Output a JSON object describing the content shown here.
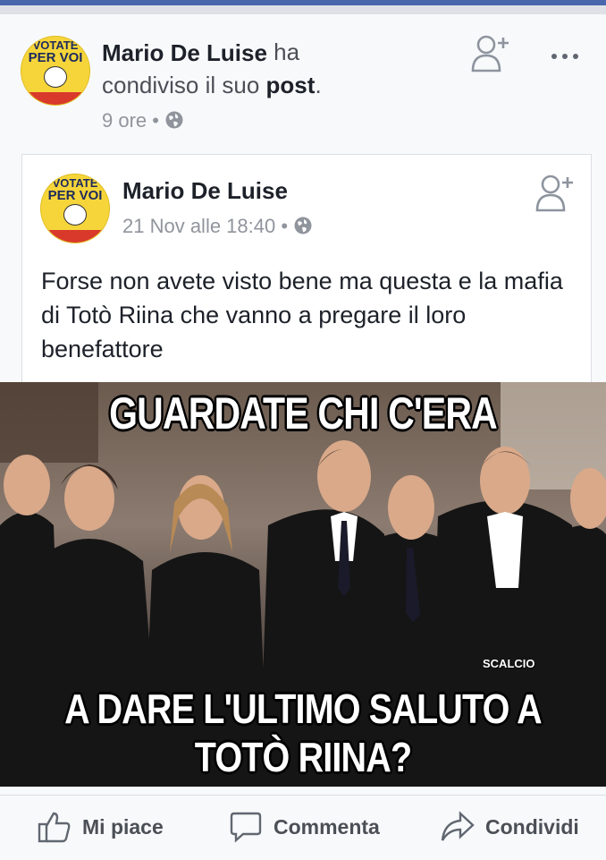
{
  "shared_post": {
    "author": "Mario De Luise",
    "action_prefix": "ha",
    "action_line2": "condiviso il suo",
    "action_bold": "post",
    "action_end": ".",
    "time": "9 ore",
    "separator": "•",
    "avatar_text": "VOTATE PER VOI",
    "avatar_icon": "movimento-logo"
  },
  "original_post": {
    "author": "Mario De Luise",
    "time": "21 Nov alle 18:40",
    "separator": "•",
    "text": "Forse non avete visto bene ma questa e la mafia di Totò Riina che vanno a pregare il loro benefattore",
    "avatar_text": "VOTATE PER VOI"
  },
  "image": {
    "top_caption": "GUARDATE CHI C'ERA",
    "bottom_caption_line1": "A DARE L'ULTIMO SALUTO A",
    "bottom_caption_line2": "TOTÒ RIINA?",
    "watermark": "SCALCIO"
  },
  "actions": {
    "like": "Mi piace",
    "comment": "Commenta",
    "share": "Condividi"
  },
  "colors": {
    "brand": "#4a67ad",
    "avatar_yellow": "#f6d53a",
    "text_primary": "#1d2129",
    "text_secondary": "#90949c"
  }
}
